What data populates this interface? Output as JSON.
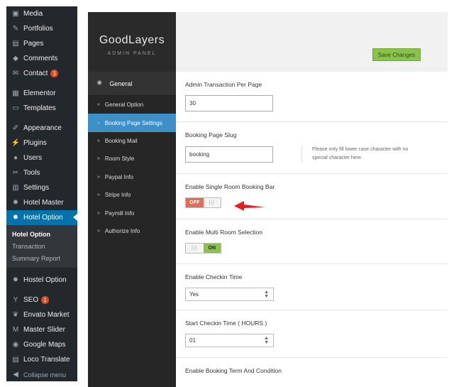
{
  "wp_menu": {
    "items": [
      {
        "label": "Media",
        "icon": "media-icon",
        "glyph": "▣"
      },
      {
        "label": "Portfolios",
        "icon": "pin-icon",
        "glyph": "✎"
      },
      {
        "label": "Pages",
        "icon": "pages-icon",
        "glyph": "▤"
      },
      {
        "label": "Comments",
        "icon": "comments-icon",
        "glyph": "◆"
      },
      {
        "label": "Contact",
        "icon": "mail-icon",
        "glyph": "✉",
        "badge": "1"
      },
      {
        "label": "Elementor",
        "icon": "elementor-icon",
        "glyph": "▦"
      },
      {
        "label": "Templates",
        "icon": "folder-icon",
        "glyph": "▭"
      },
      {
        "label": "Appearance",
        "icon": "brush-icon",
        "glyph": "✐"
      },
      {
        "label": "Plugins",
        "icon": "plug-icon",
        "glyph": "⚡"
      },
      {
        "label": "Users",
        "icon": "user-icon",
        "glyph": "●"
      },
      {
        "label": "Tools",
        "icon": "wrench-icon",
        "glyph": "✂"
      },
      {
        "label": "Settings",
        "icon": "sliders-icon",
        "glyph": "▥"
      },
      {
        "label": "Hotel Master",
        "icon": "gear-icon",
        "glyph": "✹"
      },
      {
        "label": "Hotel Option",
        "icon": "gear-icon",
        "glyph": "✹"
      }
    ],
    "submenu": [
      "Hotel Option",
      "Transaction",
      "Summary Report"
    ],
    "items_after": [
      {
        "label": "Hostel Option",
        "icon": "gear-icon",
        "glyph": "✹"
      },
      {
        "label": "SEO",
        "icon": "yoast-icon",
        "glyph": "Y",
        "badge": "1"
      },
      {
        "label": "Envato Market",
        "icon": "leaf-icon",
        "glyph": "❦"
      },
      {
        "label": "Master Slider",
        "icon": "slider-icon",
        "glyph": "M"
      },
      {
        "label": "Google Maps",
        "icon": "map-icon",
        "glyph": "◉"
      },
      {
        "label": "Loco Translate",
        "icon": "translate-icon",
        "glyph": "▤"
      },
      {
        "label": "Collapse menu",
        "icon": "collapse-icon",
        "glyph": "◀"
      }
    ]
  },
  "panel": {
    "brand": "GoodLayers",
    "brand_sub": "ADMIN PANEL",
    "section": "General",
    "menu": [
      "General Option",
      "Booking Page Settings",
      "Booking Mail",
      "Room Style",
      "Paypal Info",
      "Stripe Info",
      "Paymill Info",
      "Authorize Info"
    ],
    "active_menu": "Booking Page Settings",
    "save_label": "Save Changes"
  },
  "settings": {
    "transaction_per_page": {
      "title": "Admin Transaction Per Page",
      "value": "30"
    },
    "booking_slug": {
      "title": "Booking Page Slug",
      "value": "booking",
      "help": "Please only fill lower case character with no special character here."
    },
    "single_room_bar": {
      "title": "Enable Single Room Booking Bar",
      "state": "OFF",
      "grip": "|||"
    },
    "multi_room": {
      "title": "Enable Multi Room Selection",
      "state": "ON",
      "grip": "|||"
    },
    "checkin_time": {
      "title": "Enable Checkin Time",
      "value": "Yes"
    },
    "start_checkin": {
      "title": "Start Checkin Time ( HOURS )",
      "value": "01"
    },
    "booking_term": {
      "title": "Enable Booking Term And Condition"
    }
  },
  "colors": {
    "accent": "#0073aa",
    "active_menu": "#3d8fc8",
    "save": "#8bc34a",
    "off": "#e66c5a",
    "arrow": "#e02020"
  }
}
